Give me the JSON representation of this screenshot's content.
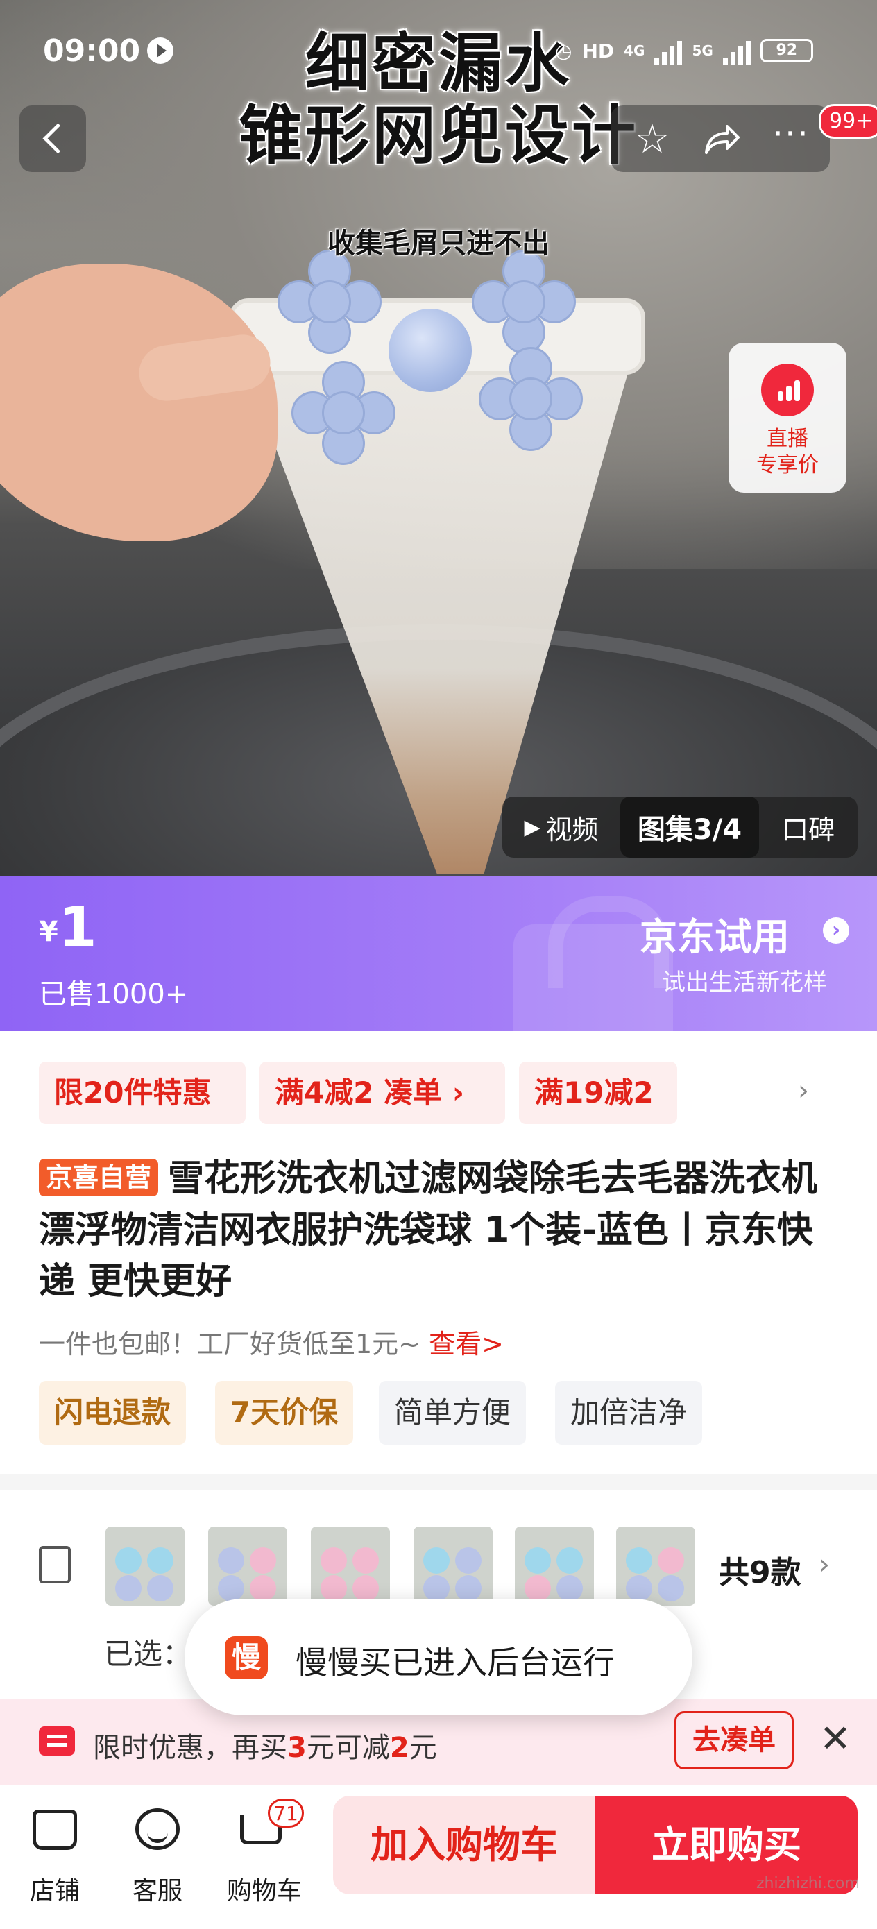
{
  "status_bar": {
    "time": "09:00",
    "network_1": "4G",
    "network_2": "5G",
    "hd": "HD",
    "battery": "92"
  },
  "hero": {
    "headline_line1": "细密漏水",
    "headline_line2": "锥形网兜设计",
    "subheadline": "收集毛屑只进不出",
    "cart_badge": "99+",
    "live_label_1": "直播",
    "live_label_2": "专享价",
    "media_tabs": {
      "video": "视频",
      "gallery": "图集3/4",
      "review": "口碑"
    }
  },
  "price_banner": {
    "currency": "¥",
    "price": "1",
    "sold": "已售1000+",
    "trial_title": "京东试用",
    "trial_subtitle": "试出生活新花样"
  },
  "promos": [
    "限20件特惠",
    "满4减2  凑单 ›",
    "满19减2"
  ],
  "product": {
    "badge": "京喜自营",
    "title": "雪花形洗衣机过滤网袋除毛去毛器洗衣机漂浮物清洁网衣服护洗袋球 1个装-蓝色丨京东快递 更快更好",
    "subline": "一件也包邮！工厂好货低至1元~ ",
    "subline_link": "查看>",
    "tags": [
      "闪电退款",
      "7天价保",
      "简单方便",
      "加倍洁净"
    ]
  },
  "variants": {
    "count_label": "共9款",
    "selected_label": "已选："
  },
  "toast": {
    "icon_text": "慢",
    "text": "慢慢买已进入后台运行"
  },
  "coupon": {
    "text_before": "限时优惠，再买",
    "amount_1": "3",
    "text_mid": "元可减",
    "amount_2": "2",
    "text_after": "元",
    "button": "去凑单"
  },
  "bottom_bar": {
    "shop_label": "店铺",
    "service_label": "客服",
    "cart_label": "购物车",
    "cart_count": "71",
    "add_to_cart": "加入购物车",
    "buy_now": "立即购买"
  },
  "watermark": "zhizhizhi.com",
  "colors": {
    "accent_red": "#e2231a",
    "banner_purple": "#a37cf7",
    "buy_red": "#f0283c"
  }
}
